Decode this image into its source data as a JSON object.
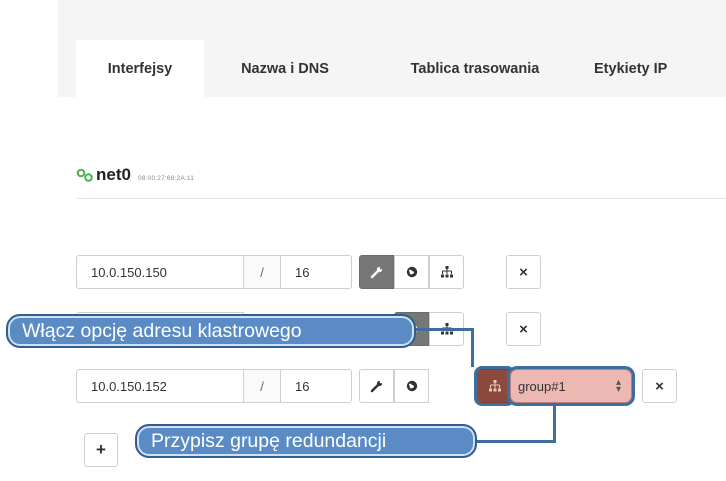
{
  "tabs": [
    {
      "label": "Interfejsy",
      "active": true
    },
    {
      "label": "Nazwa i DNS",
      "active": false
    },
    {
      "label": "Tablica trasowania",
      "active": false
    },
    {
      "label": "Etykiety IP",
      "active": false
    }
  ],
  "interface": {
    "name": "net0",
    "mac": "08:00:27:68:2A:11",
    "icon": "link-icon"
  },
  "address_rows": [
    {
      "ip": "10.0.150.150",
      "separator": "/",
      "mask": "16"
    },
    {
      "ip": "",
      "separator": "/",
      "mask": ""
    },
    {
      "ip": "10.0.150.152",
      "separator": "/",
      "mask": "16",
      "group": "group#1"
    }
  ],
  "buttons": {
    "add_label": "+",
    "remove_label": "×",
    "settings_icon": "wrench-icon",
    "globe_icon": "globe-icon",
    "cluster_icon": "sitemap-icon"
  },
  "callouts": {
    "cluster_address": "Włącz opcję adresu klastrowego",
    "redundancy_group": "Przypisz grupę redundancji"
  },
  "colors": {
    "active_button": "#777777",
    "highlight_button": "#8c4a3f",
    "select_bg": "#edb8b1",
    "callout_bg": "#5a8bc4",
    "callout_border": "#2f5f91"
  }
}
